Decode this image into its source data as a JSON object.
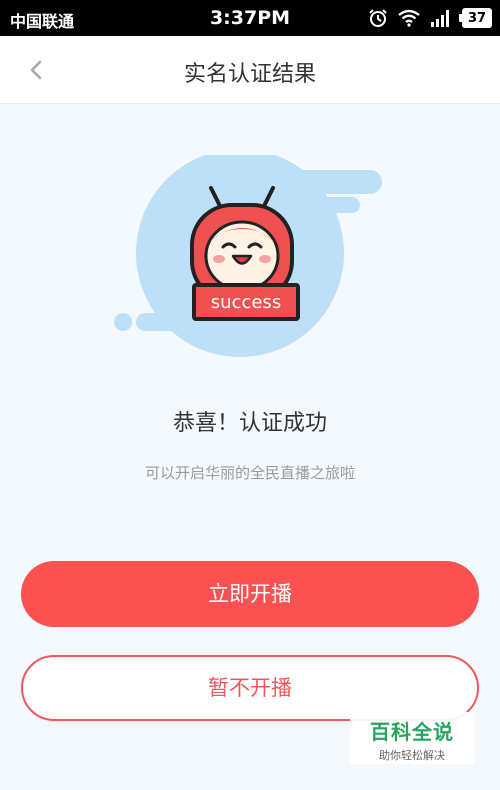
{
  "status_bar": {
    "carrier": "中国联通",
    "time": "3:37PM",
    "battery": "37",
    "icons": [
      "alarm-icon",
      "wifi-icon",
      "signal-icon",
      "battery-icon"
    ]
  },
  "nav": {
    "title": "实名认证结果",
    "back_icon": "chevron-left-icon"
  },
  "hero": {
    "badge_text": "success"
  },
  "result": {
    "title": "恭喜！认证成功",
    "subtitle": "可以开启华丽的全民直播之旅啦"
  },
  "actions": {
    "start_live": "立即开播",
    "later": "暂不开播"
  },
  "watermark": {
    "title": "百科全说",
    "subtitle": "助你轻松解决"
  },
  "colors": {
    "accent": "#fb5251",
    "accent_border": "#f2585b",
    "background": "#f4f9fd",
    "hero_blue": "#bde0f8",
    "watermark_green": "#25a55f"
  }
}
